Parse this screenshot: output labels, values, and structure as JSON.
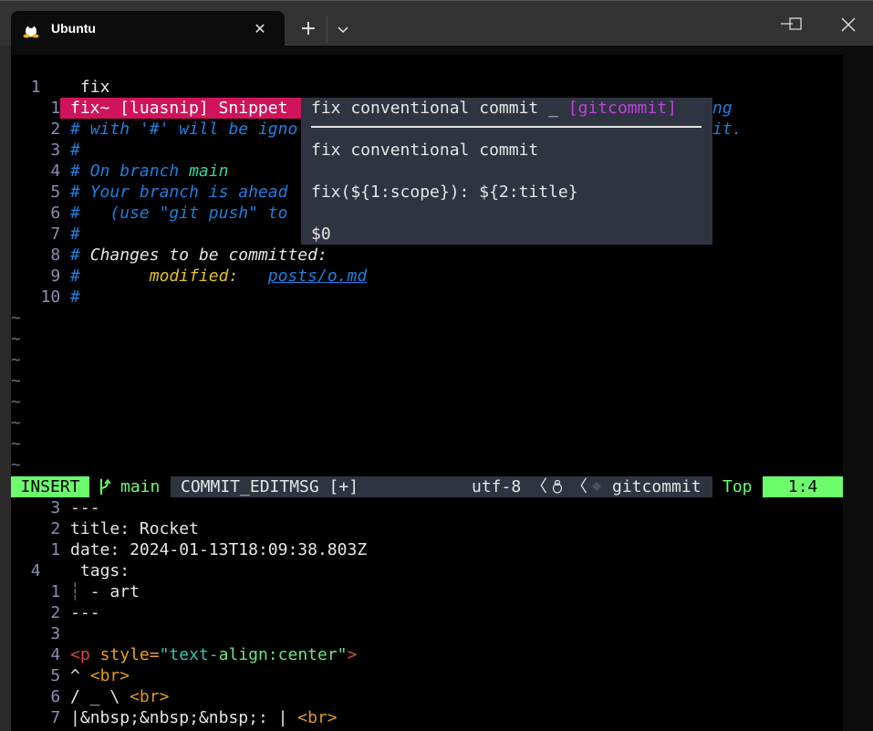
{
  "window": {
    "tab_title": "Ubuntu",
    "tab_icon": "linux-penguin-icon",
    "new_tab_label": "+",
    "controls": [
      "minimize",
      "maximize",
      "close"
    ]
  },
  "editor_top": {
    "current_line": {
      "number": "1",
      "text": "fix"
    },
    "completion_item": {
      "label": "fix~ [luasnip] Snippet",
      "number": "1"
    },
    "lines": [
      {
        "n": "2",
        "text": "# with '#' will be igno",
        "tail": "ng"
      },
      {
        "n": "3",
        "text": "#"
      },
      {
        "n": "4",
        "prefix": "# On branch ",
        "branch": "main"
      },
      {
        "n": "5",
        "text": "# Your branch is ahead"
      },
      {
        "n": "6",
        "text": "#   (use \"git push\" to"
      },
      {
        "n": "7",
        "text": "#"
      },
      {
        "n": "8",
        "hash": "# ",
        "text": "Changes to be committed:"
      },
      {
        "n": "9",
        "hash": "#",
        "modified": "       modified:",
        "path": "posts/o.md"
      },
      {
        "n": "10",
        "text": "#"
      }
    ],
    "line2_tail_row1": "ng",
    "line2_tail_row2": "it.",
    "tilde": "~",
    "tilde_count": 8
  },
  "completion_doc": {
    "title": "fix conventional commit _ ",
    "filetype": "[gitcommit]",
    "description": "fix conventional commit",
    "body": "fix(${1:scope}): ${2:title}",
    "end": "$0"
  },
  "statusline": {
    "mode": "INSERT",
    "branch": "main",
    "filename": "COMMIT_EDITMSG [+]",
    "encoding": "utf-8",
    "separator": "〈",
    "filetype": "gitcommit",
    "scroll": "Top",
    "position": "1:4"
  },
  "editor_bottom": {
    "lines": [
      {
        "n": "3",
        "text": "---"
      },
      {
        "n": "2",
        "key": "title:",
        "val": " Rocket"
      },
      {
        "n": "1",
        "key": "date:",
        "val": " 2024-01-13T18:09:38.803Z"
      },
      {
        "n": "4",
        "key": "tags:",
        "current": true
      },
      {
        "n": "1",
        "guide": "┆",
        "text": " - art"
      },
      {
        "n": "2",
        "text": "---"
      },
      {
        "n": "3",
        "text": ""
      },
      {
        "n": "4",
        "open": "<p",
        "attr": " style=",
        "q1": "\"text-",
        "q2": "align:center\"",
        "close": ">"
      },
      {
        "n": "5",
        "text": "^ ",
        "tag": "<br>"
      },
      {
        "n": "6",
        "text": "/ _ \\ ",
        "tag": "<br>"
      },
      {
        "n": "7",
        "text": "|&nbsp;&nbsp;&nbsp;: | ",
        "tag": "<br>"
      }
    ]
  }
}
